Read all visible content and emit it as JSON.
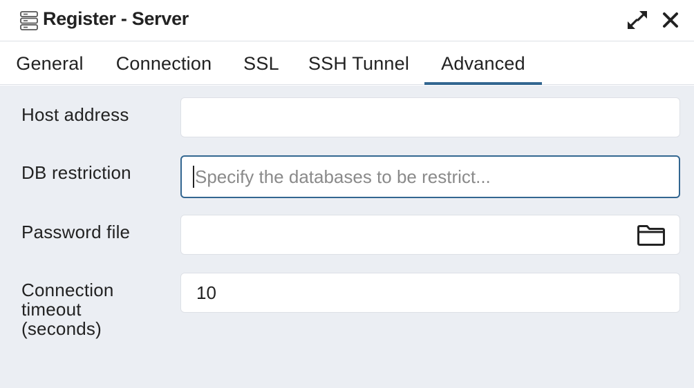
{
  "window": {
    "title": "Register - Server",
    "icons": {
      "title": "server-icon",
      "expand": "expand-icon",
      "close": "close-icon"
    }
  },
  "tabs": [
    {
      "label": "General",
      "active": false
    },
    {
      "label": "Connection",
      "active": false
    },
    {
      "label": "SSL",
      "active": false
    },
    {
      "label": "SSH Tunnel",
      "active": false
    },
    {
      "label": "Advanced",
      "active": true
    }
  ],
  "form": {
    "host_address": {
      "label": "Host address",
      "value": "",
      "placeholder": ""
    },
    "db_restriction": {
      "label": "DB restriction",
      "value": "",
      "placeholder": "Specify the databases to be restrict..."
    },
    "password_file": {
      "label": "Password file",
      "value": "",
      "placeholder": "",
      "icon": "folder-icon"
    },
    "connection_timeout": {
      "label_lines": [
        "Connection",
        "timeout",
        "(seconds)"
      ],
      "value": "10",
      "placeholder": ""
    }
  },
  "colors": {
    "accent": "#326690",
    "panel_background": "#ebeef3",
    "border": "#dde0e6",
    "text": "#222222",
    "placeholder": "#8a8a8a"
  }
}
